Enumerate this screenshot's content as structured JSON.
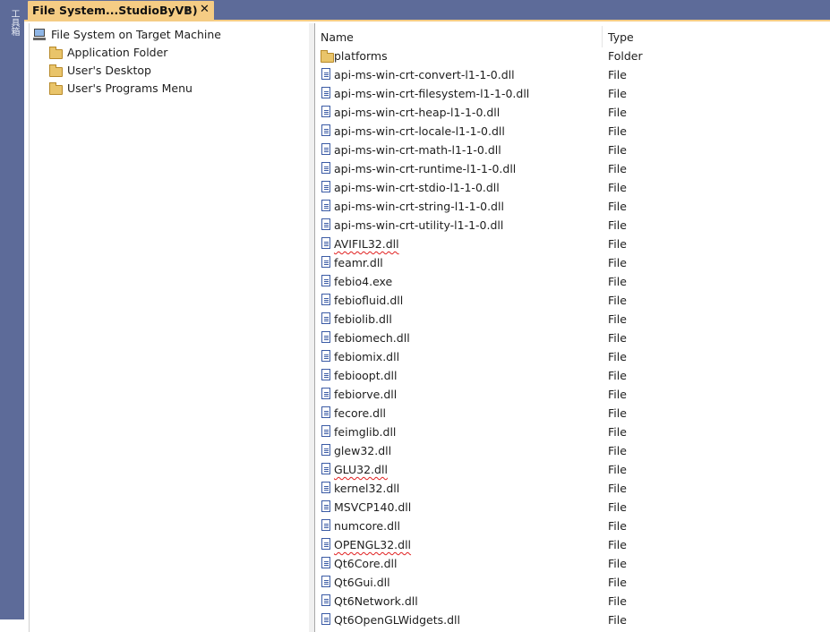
{
  "side_panel": {
    "label": "工具箱"
  },
  "document_tab": {
    "title": "File System...StudioByVB)",
    "pin_glyph": "⊥",
    "close_glyph": "✕"
  },
  "tree": {
    "root": {
      "label": "File System on Target Machine",
      "icon": "computer-icon"
    },
    "children": [
      {
        "label": "Application Folder",
        "icon": "folder-icon"
      },
      {
        "label": "User's Desktop",
        "icon": "folder-icon"
      },
      {
        "label": "User's Programs Menu",
        "icon": "folder-icon"
      }
    ]
  },
  "list": {
    "columns": [
      {
        "label": "Name"
      },
      {
        "label": "Type"
      }
    ],
    "rows": [
      {
        "name": "platforms",
        "type": "Folder",
        "icon": "folder-icon",
        "squiggle": false
      },
      {
        "name": "api-ms-win-crt-convert-l1-1-0.dll",
        "type": "File",
        "icon": "file-icon",
        "squiggle": false
      },
      {
        "name": "api-ms-win-crt-filesystem-l1-1-0.dll",
        "type": "File",
        "icon": "file-icon",
        "squiggle": false
      },
      {
        "name": "api-ms-win-crt-heap-l1-1-0.dll",
        "type": "File",
        "icon": "file-icon",
        "squiggle": false
      },
      {
        "name": "api-ms-win-crt-locale-l1-1-0.dll",
        "type": "File",
        "icon": "file-icon",
        "squiggle": false
      },
      {
        "name": "api-ms-win-crt-math-l1-1-0.dll",
        "type": "File",
        "icon": "file-icon",
        "squiggle": false
      },
      {
        "name": "api-ms-win-crt-runtime-l1-1-0.dll",
        "type": "File",
        "icon": "file-icon",
        "squiggle": false
      },
      {
        "name": "api-ms-win-crt-stdio-l1-1-0.dll",
        "type": "File",
        "icon": "file-icon",
        "squiggle": false
      },
      {
        "name": "api-ms-win-crt-string-l1-1-0.dll",
        "type": "File",
        "icon": "file-icon",
        "squiggle": false
      },
      {
        "name": "api-ms-win-crt-utility-l1-1-0.dll",
        "type": "File",
        "icon": "file-icon",
        "squiggle": false
      },
      {
        "name": "AVIFIL32.dll",
        "type": "File",
        "icon": "file-icon",
        "squiggle": true
      },
      {
        "name": "feamr.dll",
        "type": "File",
        "icon": "file-icon",
        "squiggle": false
      },
      {
        "name": "febio4.exe",
        "type": "File",
        "icon": "file-icon",
        "squiggle": false
      },
      {
        "name": "febiofluid.dll",
        "type": "File",
        "icon": "file-icon",
        "squiggle": false
      },
      {
        "name": "febiolib.dll",
        "type": "File",
        "icon": "file-icon",
        "squiggle": false
      },
      {
        "name": "febiomech.dll",
        "type": "File",
        "icon": "file-icon",
        "squiggle": false
      },
      {
        "name": "febiomix.dll",
        "type": "File",
        "icon": "file-icon",
        "squiggle": false
      },
      {
        "name": "febioopt.dll",
        "type": "File",
        "icon": "file-icon",
        "squiggle": false
      },
      {
        "name": "febiorve.dll",
        "type": "File",
        "icon": "file-icon",
        "squiggle": false
      },
      {
        "name": "fecore.dll",
        "type": "File",
        "icon": "file-icon",
        "squiggle": false
      },
      {
        "name": "feimglib.dll",
        "type": "File",
        "icon": "file-icon",
        "squiggle": false
      },
      {
        "name": "glew32.dll",
        "type": "File",
        "icon": "file-icon",
        "squiggle": false
      },
      {
        "name": "GLU32.dll",
        "type": "File",
        "icon": "file-icon",
        "squiggle": true
      },
      {
        "name": "kernel32.dll",
        "type": "File",
        "icon": "file-icon",
        "squiggle": false
      },
      {
        "name": "MSVCP140.dll",
        "type": "File",
        "icon": "file-icon",
        "squiggle": false
      },
      {
        "name": "numcore.dll",
        "type": "File",
        "icon": "file-icon",
        "squiggle": false
      },
      {
        "name": "OPENGL32.dll",
        "type": "File",
        "icon": "file-icon",
        "squiggle": true
      },
      {
        "name": "Qt6Core.dll",
        "type": "File",
        "icon": "file-icon",
        "squiggle": false
      },
      {
        "name": "Qt6Gui.dll",
        "type": "File",
        "icon": "file-icon",
        "squiggle": false
      },
      {
        "name": "Qt6Network.dll",
        "type": "File",
        "icon": "file-icon",
        "squiggle": false
      },
      {
        "name": "Qt6OpenGLWidgets.dll",
        "type": "File",
        "icon": "file-icon",
        "squiggle": false
      }
    ]
  },
  "colors": {
    "frame": "#5d6b99",
    "active_tab": "#f5cc84",
    "squiggle": "#e02020"
  }
}
